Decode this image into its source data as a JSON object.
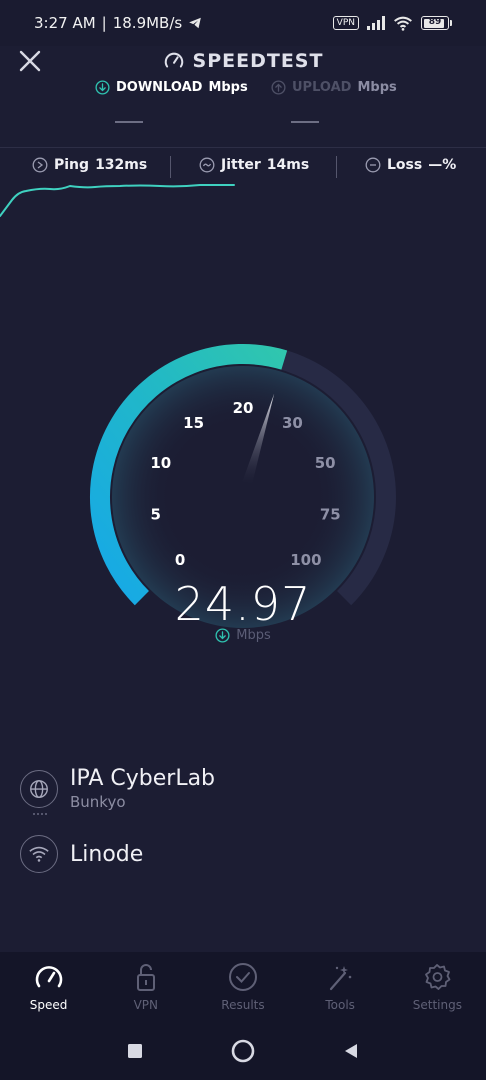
{
  "status_bar": {
    "time": "3:27 AM",
    "separator": "|",
    "net_speed": "18.9MB/s",
    "vpn": "VPN",
    "battery": "89"
  },
  "header": {
    "title": "SPEEDTEST",
    "download_label": "DOWNLOAD",
    "download_unit": "Mbps",
    "upload_label": "UPLOAD",
    "upload_unit": "Mbps"
  },
  "metrics": {
    "ping_label": "Ping",
    "ping_value": "132ms",
    "jitter_label": "Jitter",
    "jitter_value": "14ms",
    "loss_label": "Loss",
    "loss_value": "—%"
  },
  "gauge": {
    "ticks": [
      "0",
      "5",
      "10",
      "15",
      "20",
      "30",
      "50",
      "75",
      "100"
    ],
    "current_value": "24.97",
    "unit": "Mbps",
    "accent_color": "#2fc2b0",
    "accent_color_low": "#1a9fe0"
  },
  "server": {
    "provider": "IPA CyberLab",
    "location": "Bunkyo",
    "host": "Linode"
  },
  "nav": {
    "items": [
      {
        "label": "Speed",
        "icon": "speedometer-icon"
      },
      {
        "label": "VPN",
        "icon": "lock-icon"
      },
      {
        "label": "Results",
        "icon": "check-circle-icon"
      },
      {
        "label": "Tools",
        "icon": "magic-wand-icon"
      },
      {
        "label": "Settings",
        "icon": "gear-icon"
      }
    ]
  }
}
